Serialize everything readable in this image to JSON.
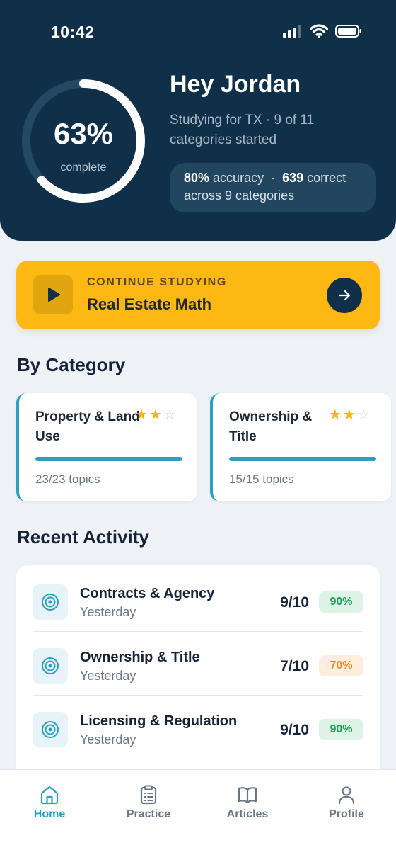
{
  "status_bar": {
    "time": "10:42"
  },
  "progress": {
    "percent_value": 63,
    "percent_text": "63%",
    "label": "complete"
  },
  "header": {
    "greeting": "Hey Jordan",
    "subtitle": "Studying for TX · 9 of 11 categories started",
    "stats": {
      "accuracy_value": "80%",
      "accuracy_label": "accuracy",
      "separator": "·",
      "correct_value": "639",
      "correct_label": "correct",
      "line2": "across 9 categories"
    }
  },
  "continue": {
    "kicker": "CONTINUE STUDYING",
    "title": "Real Estate Math"
  },
  "by_category": {
    "title": "By Category",
    "items": [
      {
        "name": "Property & Land Use",
        "stars_filled": 2,
        "stars_total": 3,
        "progress_fraction": 1.0,
        "topics": "23/23 topics"
      },
      {
        "name": "Ownership & Title",
        "stars_filled": 2,
        "stars_total": 3,
        "progress_fraction": 1.0,
        "topics": "15/15 topics"
      }
    ]
  },
  "recent_activity": {
    "title": "Recent Activity",
    "items": [
      {
        "title": "Contracts & Agency",
        "date": "Yesterday",
        "score": "9/10",
        "percent": "90%",
        "badge_color": "#1f9a57"
      },
      {
        "title": "Ownership & Title",
        "date": "Yesterday",
        "score": "7/10",
        "percent": "70%",
        "badge_color": "#ec8a25"
      },
      {
        "title": "Licensing & Regulation",
        "date": "Yesterday",
        "score": "9/10",
        "percent": "90%",
        "badge_color": "#1f9a57"
      }
    ]
  },
  "tabbar": {
    "tabs": [
      {
        "label": "Home",
        "icon": "home-icon",
        "active": true
      },
      {
        "label": "Practice",
        "icon": "clipboard-icon",
        "active": false
      },
      {
        "label": "Articles",
        "icon": "book-icon",
        "active": false
      },
      {
        "label": "Profile",
        "icon": "person-icon",
        "active": false
      }
    ]
  },
  "colors": {
    "header_bg": "#0f3048",
    "accent": "#2a9fbe",
    "continue_bg": "#fdb814",
    "star": "#f4b41a"
  }
}
